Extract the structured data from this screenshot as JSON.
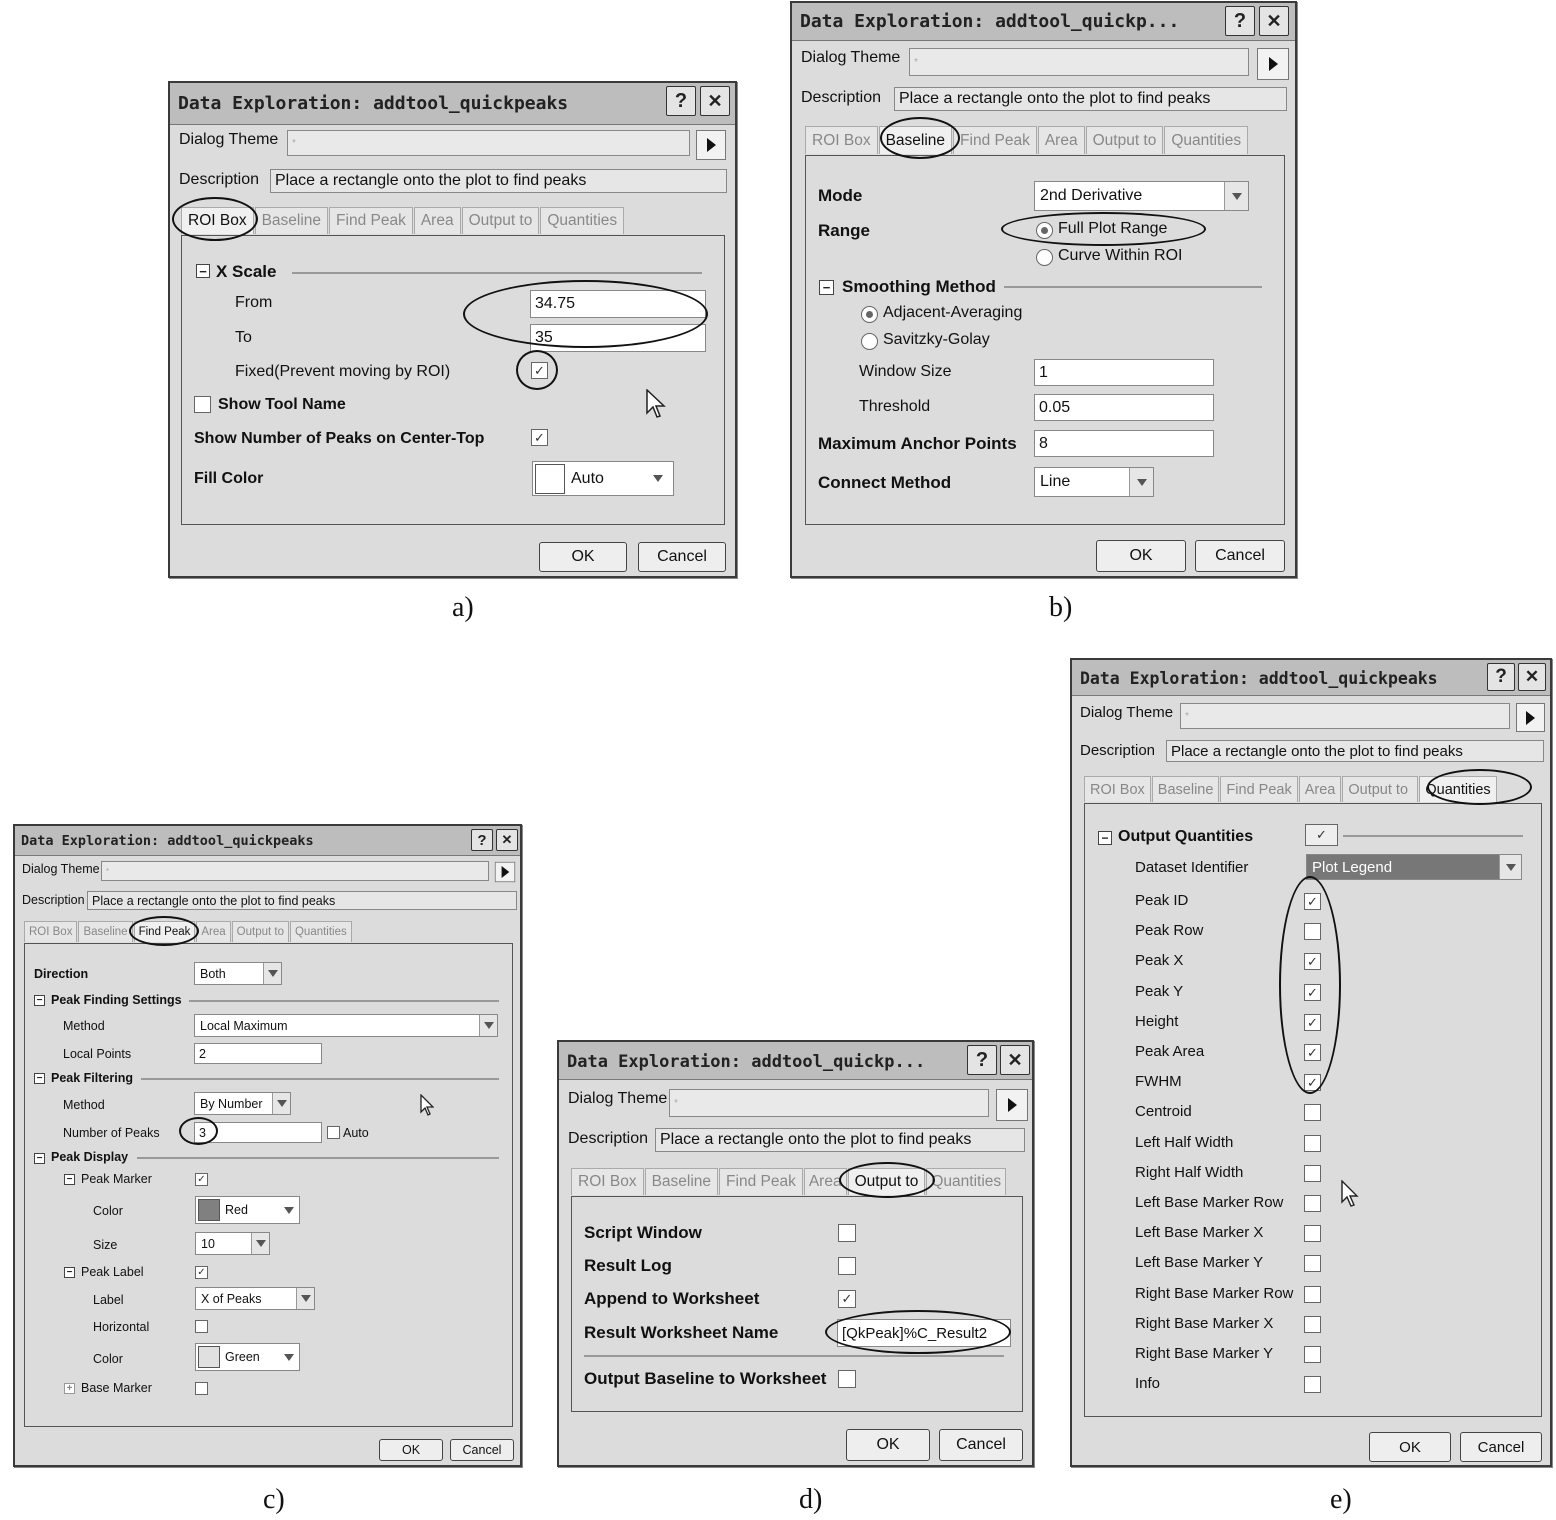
{
  "common": {
    "title_full": "Data Exploration: addtool_quickpeaks",
    "title_trunc": "Data Exploration: addtool_quickp...",
    "help_btn": "?",
    "close_btn": "✕",
    "dialog_theme_label": "Dialog Theme",
    "dialog_theme_value": "*",
    "description_label": "Description",
    "description_value": "Place a rectangle onto the plot to find peaks",
    "tabs": [
      "ROI Box",
      "Baseline",
      "Find Peak",
      "Area",
      "Output to",
      "Quantities"
    ],
    "ok": "OK",
    "cancel": "Cancel",
    "collapse": "−",
    "expand": "+"
  },
  "dialog_a": {
    "active_tab": "ROI Box",
    "x_scale": "X Scale",
    "from_label": "From",
    "from_value": "34.75",
    "to_label": "To",
    "to_value": "35",
    "fixed_label": "Fixed(Prevent moving by ROI)",
    "show_tool_name": "Show Tool Name",
    "show_peaks": "Show Number of Peaks on Center-Top",
    "fill_color_label": "Fill Color",
    "fill_color_value": "Auto",
    "caption": "a)"
  },
  "dialog_b": {
    "active_tab": "Baseline",
    "mode_label": "Mode",
    "mode_value": "2nd Derivative",
    "range_label": "Range",
    "range_opt1": "Full Plot Range",
    "range_opt2": "Curve Within ROI",
    "smoothing": "Smoothing Method",
    "smooth_opt1": "Adjacent-Averaging",
    "smooth_opt2": "Savitzky-Golay",
    "window_size_label": "Window Size",
    "window_size_value": "1",
    "threshold_label": "Threshold",
    "threshold_value": "0.05",
    "max_anchor_label": "Maximum Anchor Points",
    "max_anchor_value": "8",
    "connect_label": "Connect Method",
    "connect_value": "Line",
    "caption": "b)"
  },
  "dialog_c": {
    "active_tab": "Find Peak",
    "direction_label": "Direction",
    "direction_value": "Both",
    "pfs": "Peak Finding Settings",
    "method_label": "Method",
    "method_value": "Local Maximum",
    "local_points_label": "Local Points",
    "local_points_value": "2",
    "filtering": "Peak Filtering",
    "filter_method_label": "Method",
    "filter_method_value": "By Number",
    "num_peaks_label": "Number of Peaks",
    "num_peaks_value": "3",
    "auto_label": "Auto",
    "peak_display": "Peak Display",
    "peak_marker": "Peak Marker",
    "color_label": "Color",
    "marker_color": "Red",
    "size_label": "Size",
    "size_value": "10",
    "peak_label": "Peak Label",
    "label_label": "Label",
    "label_value": "X of Peaks",
    "horizontal_label": "Horizontal",
    "label_color": "Green",
    "base_marker": "Base Marker",
    "caption": "c)"
  },
  "dialog_d": {
    "active_tab": "Output to",
    "script_window": "Script Window",
    "result_log": "Result Log",
    "append_ws": "Append to Worksheet",
    "result_ws_name_label": "Result Worksheet Name",
    "result_ws_name_value": "[QkPeak]%C_Result2",
    "output_baseline": "Output Baseline to Worksheet",
    "caption": "d)"
  },
  "dialog_e": {
    "active_tab": "Quantities",
    "output_quantities": "Output Quantities",
    "dataset_identifier_label": "Dataset Identifier",
    "dataset_identifier_value": "Plot Legend",
    "quantities": [
      {
        "label": "Peak ID",
        "checked": true
      },
      {
        "label": "Peak Row",
        "checked": false
      },
      {
        "label": "Peak X",
        "checked": true
      },
      {
        "label": "Peak Y",
        "checked": true
      },
      {
        "label": "Height",
        "checked": true
      },
      {
        "label": "Peak Area",
        "checked": true
      },
      {
        "label": "FWHM",
        "checked": true
      },
      {
        "label": "Centroid",
        "checked": false
      },
      {
        "label": "Left Half Width",
        "checked": false
      },
      {
        "label": "Right Half Width",
        "checked": false
      },
      {
        "label": "Left Base Marker Row",
        "checked": false
      },
      {
        "label": "Left Base Marker X",
        "checked": false
      },
      {
        "label": "Left Base Marker Y",
        "checked": false
      },
      {
        "label": "Right Base Marker Row",
        "checked": false
      },
      {
        "label": "Right Base Marker X",
        "checked": false
      },
      {
        "label": "Right Base Marker Y",
        "checked": false
      },
      {
        "label": "Info",
        "checked": false
      }
    ],
    "caption": "e)"
  },
  "colors": {
    "marker_red": "#808080",
    "label_green": "#e0e0e0",
    "highlight_row": "#777777"
  }
}
